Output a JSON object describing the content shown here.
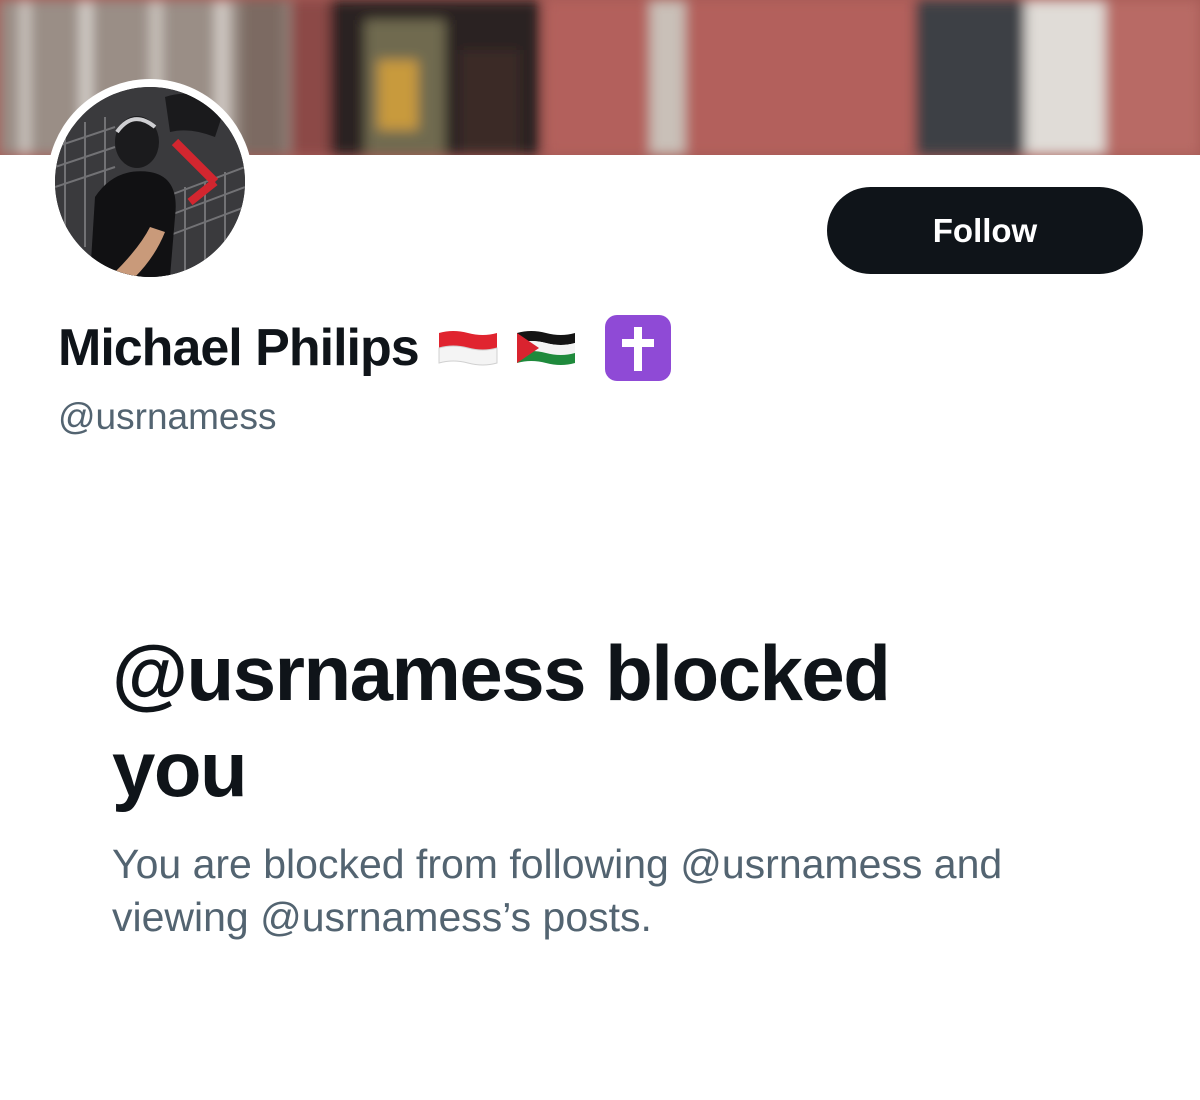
{
  "profile": {
    "display_name": "Michael Philips",
    "handle": "@usrnamess",
    "badges": [
      "indonesia-flag-icon",
      "palestine-flag-icon",
      "latin-cross-icon"
    ]
  },
  "actions": {
    "follow_label": "Follow"
  },
  "blocked": {
    "title": "@usrnamess blocked you",
    "description": "You are blocked from following @usrnamess and viewing @usrnamess’s posts."
  },
  "colors": {
    "primary_text": "#0f1419",
    "secondary_text": "#536471",
    "button_bg": "#0f1419",
    "cross_badge": "#8f4ad6"
  }
}
